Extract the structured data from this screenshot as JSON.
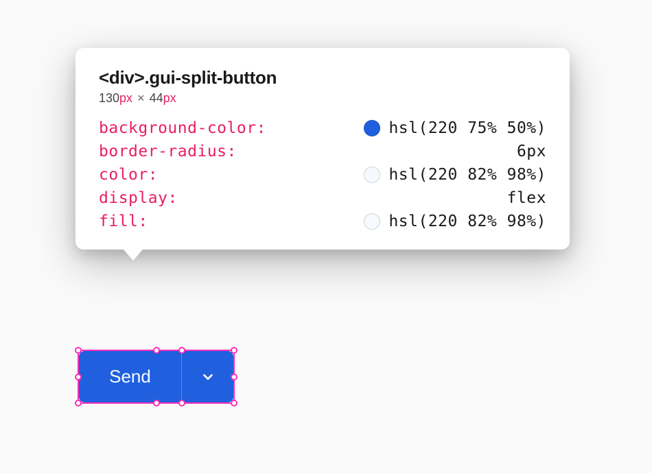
{
  "tooltip": {
    "element": {
      "tag": "<div>",
      "class": ".gui-split-button"
    },
    "dimensions": {
      "width": "130",
      "widthUnit": "px",
      "times": "×",
      "height": "44",
      "heightUnit": "px"
    },
    "properties": [
      {
        "name": "background-color",
        "value": "hsl(220 75% 50%)",
        "swatch": "blue"
      },
      {
        "name": "border-radius",
        "value": "6px",
        "swatch": null
      },
      {
        "name": "color",
        "value": "hsl(220 82% 98%)",
        "swatch": "white"
      },
      {
        "name": "display",
        "value": "flex",
        "swatch": null
      },
      {
        "name": "fill",
        "value": "hsl(220 82% 98%)",
        "swatch": "white"
      }
    ]
  },
  "button": {
    "mainLabel": "Send",
    "colors": {
      "background": "hsl(220 75% 50%)",
      "text": "hsl(220 82% 98%)",
      "fill": "hsl(220 82% 98%)"
    }
  }
}
